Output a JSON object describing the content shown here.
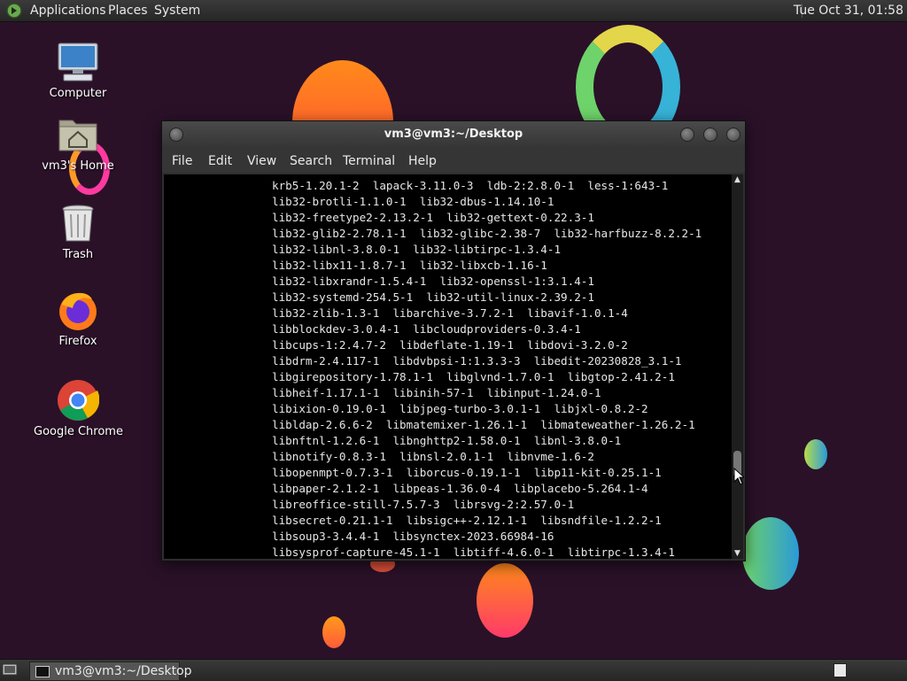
{
  "top_panel": {
    "menus": [
      "Applications",
      "Places",
      "System"
    ],
    "clock": "Tue Oct 31, 01:58"
  },
  "desktop_icons": [
    {
      "label": "Computer",
      "icon": "computer-icon"
    },
    {
      "label": "vm3's Home",
      "icon": "home-folder-icon"
    },
    {
      "label": "Trash",
      "icon": "trash-icon"
    },
    {
      "label": "Firefox",
      "icon": "firefox-icon"
    },
    {
      "label": "Google Chrome",
      "icon": "chrome-icon"
    }
  ],
  "window": {
    "title": "vm3@vm3:~/Desktop",
    "menus": [
      "File",
      "Edit",
      "View",
      "Search",
      "Terminal",
      "Help"
    ]
  },
  "terminal": {
    "lines": [
      "krb5-1.20.1-2  lapack-3.11.0-3  ldb-2:2.8.0-1  less-1:643-1",
      "lib32-brotli-1.1.0-1  lib32-dbus-1.14.10-1",
      "lib32-freetype2-2.13.2-1  lib32-gettext-0.22.3-1",
      "lib32-glib2-2.78.1-1  lib32-glibc-2.38-7  lib32-harfbuzz-8.2.2-1",
      "lib32-libnl-3.8.0-1  lib32-libtirpc-1.3.4-1",
      "lib32-libx11-1.8.7-1  lib32-libxcb-1.16-1",
      "lib32-libxrandr-1.5.4-1  lib32-openssl-1:3.1.4-1",
      "lib32-systemd-254.5-1  lib32-util-linux-2.39.2-1",
      "lib32-zlib-1.3-1  libarchive-3.7.2-1  libavif-1.0.1-4",
      "libblockdev-3.0.4-1  libcloudproviders-0.3.4-1",
      "libcups-1:2.4.7-2  libdeflate-1.19-1  libdovi-3.2.0-2",
      "libdrm-2.4.117-1  libdvbpsi-1:1.3.3-3  libedit-20230828_3.1-1",
      "libgirepository-1.78.1-1  libglvnd-1.7.0-1  libgtop-2.41.2-1",
      "libheif-1.17.1-1  libinih-57-1  libinput-1.24.0-1",
      "libixion-0.19.0-1  libjpeg-turbo-3.0.1-1  libjxl-0.8.2-2",
      "libldap-2.6.6-2  libmatemixer-1.26.1-1  libmateweather-1.26.2-1",
      "libnftnl-1.2.6-1  libnghttp2-1.58.0-1  libnl-3.8.0-1",
      "libnotify-0.8.3-1  libnsl-2.0.1-1  libnvme-1.6-2",
      "libopenmpt-0.7.3-1  liborcus-0.19.1-1  libp11-kit-0.25.1-1",
      "libpaper-2.1.2-1  libpeas-1.36.0-4  libplacebo-5.264.1-4",
      "libreoffice-still-7.5.7-3  librsvg-2:2.57.0-1",
      "libsecret-0.21.1-1  libsigc++-2.12.1-1  libsndfile-1.2.2-1",
      "libsoup3-3.4.4-1  libsynctex-2023.66984-16",
      "libsysprof-capture-45.1-1  libtiff-4.6.0-1  libtirpc-1.3.4-1"
    ]
  },
  "bottom_panel": {
    "task_label": "vm3@vm3:~/Desktop"
  }
}
